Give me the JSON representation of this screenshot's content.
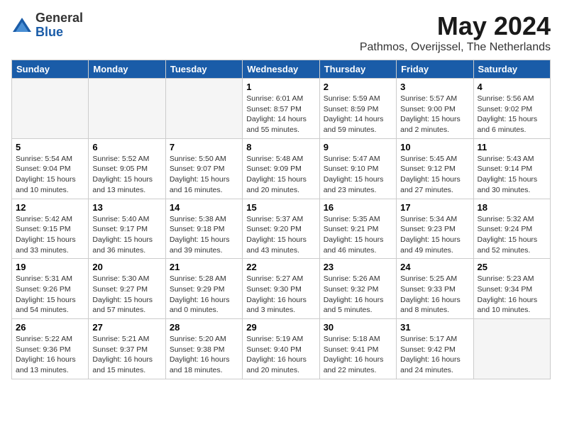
{
  "logo": {
    "general": "General",
    "blue": "Blue"
  },
  "title": "May 2024",
  "subtitle": "Pathmos, Overijssel, The Netherlands",
  "days_header": [
    "Sunday",
    "Monday",
    "Tuesday",
    "Wednesday",
    "Thursday",
    "Friday",
    "Saturday"
  ],
  "weeks": [
    [
      {
        "num": "",
        "info": ""
      },
      {
        "num": "",
        "info": ""
      },
      {
        "num": "",
        "info": ""
      },
      {
        "num": "1",
        "info": "Sunrise: 6:01 AM\nSunset: 8:57 PM\nDaylight: 14 hours\nand 55 minutes."
      },
      {
        "num": "2",
        "info": "Sunrise: 5:59 AM\nSunset: 8:59 PM\nDaylight: 14 hours\nand 59 minutes."
      },
      {
        "num": "3",
        "info": "Sunrise: 5:57 AM\nSunset: 9:00 PM\nDaylight: 15 hours\nand 2 minutes."
      },
      {
        "num": "4",
        "info": "Sunrise: 5:56 AM\nSunset: 9:02 PM\nDaylight: 15 hours\nand 6 minutes."
      }
    ],
    [
      {
        "num": "5",
        "info": "Sunrise: 5:54 AM\nSunset: 9:04 PM\nDaylight: 15 hours\nand 10 minutes."
      },
      {
        "num": "6",
        "info": "Sunrise: 5:52 AM\nSunset: 9:05 PM\nDaylight: 15 hours\nand 13 minutes."
      },
      {
        "num": "7",
        "info": "Sunrise: 5:50 AM\nSunset: 9:07 PM\nDaylight: 15 hours\nand 16 minutes."
      },
      {
        "num": "8",
        "info": "Sunrise: 5:48 AM\nSunset: 9:09 PM\nDaylight: 15 hours\nand 20 minutes."
      },
      {
        "num": "9",
        "info": "Sunrise: 5:47 AM\nSunset: 9:10 PM\nDaylight: 15 hours\nand 23 minutes."
      },
      {
        "num": "10",
        "info": "Sunrise: 5:45 AM\nSunset: 9:12 PM\nDaylight: 15 hours\nand 27 minutes."
      },
      {
        "num": "11",
        "info": "Sunrise: 5:43 AM\nSunset: 9:14 PM\nDaylight: 15 hours\nand 30 minutes."
      }
    ],
    [
      {
        "num": "12",
        "info": "Sunrise: 5:42 AM\nSunset: 9:15 PM\nDaylight: 15 hours\nand 33 minutes."
      },
      {
        "num": "13",
        "info": "Sunrise: 5:40 AM\nSunset: 9:17 PM\nDaylight: 15 hours\nand 36 minutes."
      },
      {
        "num": "14",
        "info": "Sunrise: 5:38 AM\nSunset: 9:18 PM\nDaylight: 15 hours\nand 39 minutes."
      },
      {
        "num": "15",
        "info": "Sunrise: 5:37 AM\nSunset: 9:20 PM\nDaylight: 15 hours\nand 43 minutes."
      },
      {
        "num": "16",
        "info": "Sunrise: 5:35 AM\nSunset: 9:21 PM\nDaylight: 15 hours\nand 46 minutes."
      },
      {
        "num": "17",
        "info": "Sunrise: 5:34 AM\nSunset: 9:23 PM\nDaylight: 15 hours\nand 49 minutes."
      },
      {
        "num": "18",
        "info": "Sunrise: 5:32 AM\nSunset: 9:24 PM\nDaylight: 15 hours\nand 52 minutes."
      }
    ],
    [
      {
        "num": "19",
        "info": "Sunrise: 5:31 AM\nSunset: 9:26 PM\nDaylight: 15 hours\nand 54 minutes."
      },
      {
        "num": "20",
        "info": "Sunrise: 5:30 AM\nSunset: 9:27 PM\nDaylight: 15 hours\nand 57 minutes."
      },
      {
        "num": "21",
        "info": "Sunrise: 5:28 AM\nSunset: 9:29 PM\nDaylight: 16 hours\nand 0 minutes."
      },
      {
        "num": "22",
        "info": "Sunrise: 5:27 AM\nSunset: 9:30 PM\nDaylight: 16 hours\nand 3 minutes."
      },
      {
        "num": "23",
        "info": "Sunrise: 5:26 AM\nSunset: 9:32 PM\nDaylight: 16 hours\nand 5 minutes."
      },
      {
        "num": "24",
        "info": "Sunrise: 5:25 AM\nSunset: 9:33 PM\nDaylight: 16 hours\nand 8 minutes."
      },
      {
        "num": "25",
        "info": "Sunrise: 5:23 AM\nSunset: 9:34 PM\nDaylight: 16 hours\nand 10 minutes."
      }
    ],
    [
      {
        "num": "26",
        "info": "Sunrise: 5:22 AM\nSunset: 9:36 PM\nDaylight: 16 hours\nand 13 minutes."
      },
      {
        "num": "27",
        "info": "Sunrise: 5:21 AM\nSunset: 9:37 PM\nDaylight: 16 hours\nand 15 minutes."
      },
      {
        "num": "28",
        "info": "Sunrise: 5:20 AM\nSunset: 9:38 PM\nDaylight: 16 hours\nand 18 minutes."
      },
      {
        "num": "29",
        "info": "Sunrise: 5:19 AM\nSunset: 9:40 PM\nDaylight: 16 hours\nand 20 minutes."
      },
      {
        "num": "30",
        "info": "Sunrise: 5:18 AM\nSunset: 9:41 PM\nDaylight: 16 hours\nand 22 minutes."
      },
      {
        "num": "31",
        "info": "Sunrise: 5:17 AM\nSunset: 9:42 PM\nDaylight: 16 hours\nand 24 minutes."
      },
      {
        "num": "",
        "info": ""
      }
    ]
  ]
}
